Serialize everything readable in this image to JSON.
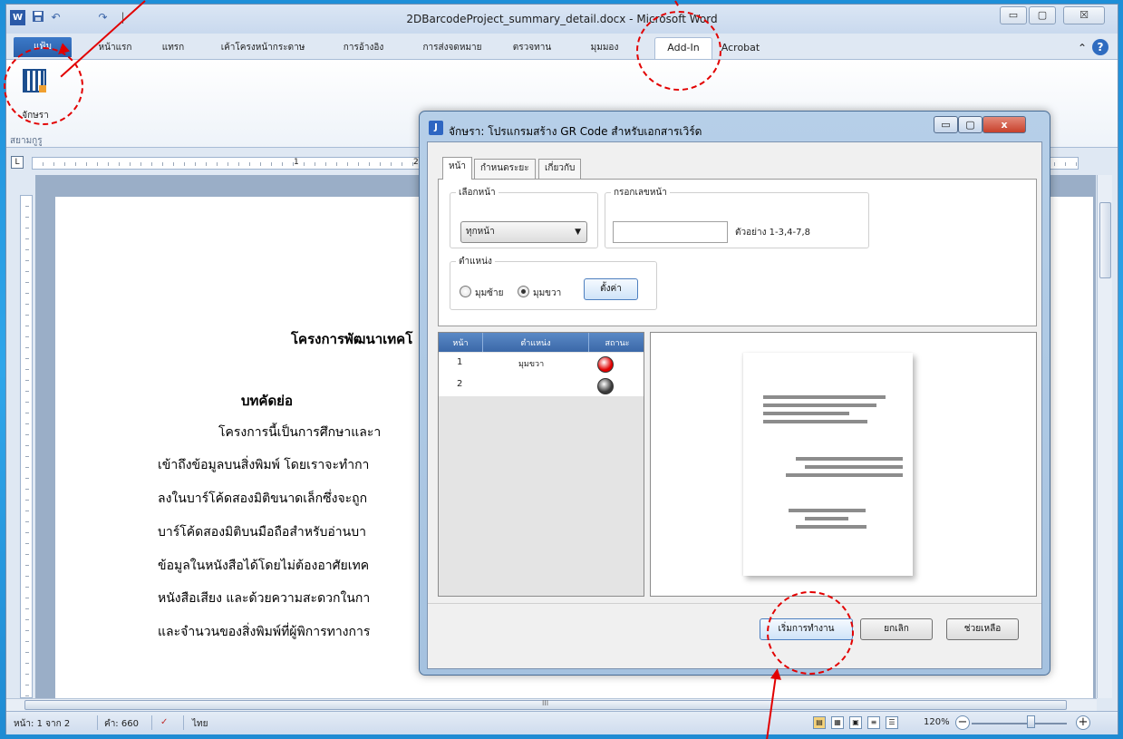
{
  "window": {
    "title": "2DBarcodeProject_summary_detail.docx - Microsoft Word",
    "minimize": "▭",
    "maximize": "▢",
    "close": "☒"
  },
  "quick_access": {
    "word_icon": "W",
    "save_icon": "save-icon",
    "undo_icon": "↶",
    "redo_icon": "↷",
    "separator": "|"
  },
  "ribbon_tabs": {
    "file": "แฟ้ม",
    "home": "หน้าแรก",
    "insert": "แทรก",
    "page_layout": "เค้าโครงหน้ากระดาษ",
    "references": "การอ้างอิง",
    "mailings": "การส่งจดหมาย",
    "review": "ตรวจทาน",
    "view": "มุมมอง",
    "addin": "Add-In",
    "acrobat": "Acrobat",
    "collapse_icon": "⌃",
    "help_icon": "?"
  },
  "ribbon": {
    "jaksra_label": "จักษรา",
    "group_label": "สยามกูรู"
  },
  "ruler": {
    "corner": "L",
    "mark_1": "1",
    "mark_2": "2"
  },
  "document": {
    "heading": "โครงการพัฒนาเทคโ",
    "abstract_title": "บทคัดย่อ",
    "lines": [
      "โครงการนี้เป็นการศึกษาและา",
      "เข้าถึงข้อมูลบนสิ่งพิมพ์ โดยเราจะทำกา",
      "ลงในบาร์โค้ดสองมิติขนาดเล็กซึ่งจะถูก",
      "บาร์โค้ดสองมิติบนมือถือสำหรับอ่านบา",
      "ข้อมูลในหนังสือได้โดยไม่ต้องอาศัยเทค",
      "หนังสือเสียง และด้วยความสะดวกในกา",
      "และจำนวนของสิ่งพิมพ์ที่ผู้พิการทางการ"
    ]
  },
  "statusbar": {
    "page": "หน้า: 1 จาก 2",
    "words": "คำ: 660",
    "language": "ไทย",
    "zoom": "120%",
    "zoom_out": "−",
    "zoom_in": "+",
    "zoom_level": 0.62,
    "hscroll_center": "III"
  },
  "dialog": {
    "icon": "J",
    "title": "จักษรา: โปรแกรมสร้าง GR Code สำหรับเอกสารเวิร์ด",
    "minimize": "▭",
    "maximize": "▢",
    "close": "x",
    "tabs": {
      "page": "หน้า",
      "range": "กำหนดระยะ",
      "about": "เกี่ยวกับ"
    },
    "select_page": {
      "legend": "เลือกหน้า",
      "value": "ทุกหน้า",
      "arrow": "▼"
    },
    "page_number": {
      "legend": "กรอกเลขหน้า",
      "value": "",
      "example": "ตัวอย่าง  1-3,4-7,8"
    },
    "position": {
      "legend": "ตำแหน่ง",
      "left": "มุมซ้าย",
      "right": "มุมขวา",
      "selected": "right",
      "set_button": "ตั้งค่า"
    },
    "grid": {
      "headers": [
        "หน้า",
        "ตำแหน่ง",
        "สถานะ"
      ],
      "rows": [
        {
          "page": "1",
          "position": "มุมขวา",
          "status_color": "#e00000"
        },
        {
          "page": "2",
          "position": "",
          "status_color": "#3a3a3a"
        }
      ]
    },
    "buttons": {
      "start": "เริ่มการทำงาน",
      "cancel": "ยกเลิก",
      "help": "ช่วยเหลือ"
    }
  },
  "colors": {
    "annotation": "#e20000",
    "status_active": "#e00000",
    "status_inactive": "#3a3a3a"
  }
}
